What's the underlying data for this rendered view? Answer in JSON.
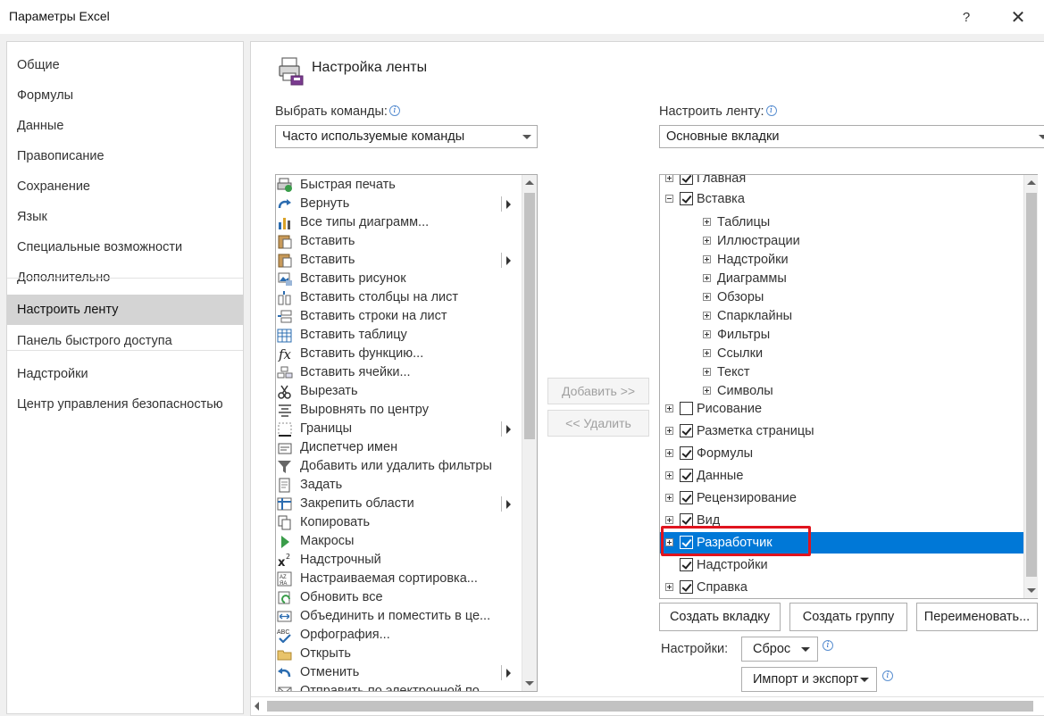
{
  "window": {
    "title": "Параметры Excel",
    "help": "?",
    "close": "✕"
  },
  "nav": {
    "items": [
      "Общие",
      "Формулы",
      "Данные",
      "Правописание",
      "Сохранение",
      "Язык",
      "Специальные возможности",
      "Дополнительно",
      "Настроить ленту",
      "Панель быстрого доступа",
      "Надстройки",
      "Центр управления безопасностью"
    ],
    "selected": "Настроить ленту"
  },
  "header": {
    "title": "Настройка ленты",
    "icon": "ribbon-customize-icon"
  },
  "commands": {
    "label": "Выбрать команды:",
    "value": "Часто используемые команды",
    "items": [
      {
        "label": "Быстрая печать",
        "icon": "quick-print-icon"
      },
      {
        "label": "Вернуть",
        "icon": "redo-icon",
        "submenu": true
      },
      {
        "label": "Все типы диаграмм...",
        "icon": "chart-types-icon"
      },
      {
        "label": "Вставить",
        "icon": "paste-icon"
      },
      {
        "label": "Вставить",
        "icon": "paste-options-icon",
        "submenu": true
      },
      {
        "label": "Вставить рисунок",
        "icon": "insert-picture-icon"
      },
      {
        "label": "Вставить столбцы на лист",
        "icon": "insert-columns-icon"
      },
      {
        "label": "Вставить строки на лист",
        "icon": "insert-rows-icon"
      },
      {
        "label": "Вставить таблицу",
        "icon": "insert-table-icon"
      },
      {
        "label": "Вставить функцию...",
        "icon": "insert-function-icon"
      },
      {
        "label": "Вставить ячейки...",
        "icon": "insert-cells-icon"
      },
      {
        "label": "Вырезать",
        "icon": "cut-icon"
      },
      {
        "label": "Выровнять по центру",
        "icon": "align-center-icon"
      },
      {
        "label": "Границы",
        "icon": "borders-icon",
        "submenu": true
      },
      {
        "label": "Диспетчер имен",
        "icon": "name-manager-icon"
      },
      {
        "label": "Добавить или удалить фильтры",
        "icon": "filter-icon"
      },
      {
        "label": "Задать",
        "icon": "set-print-area-icon"
      },
      {
        "label": "Закрепить области",
        "icon": "freeze-panes-icon",
        "submenu": true
      },
      {
        "label": "Копировать",
        "icon": "copy-icon"
      },
      {
        "label": "Макросы",
        "icon": "macros-icon"
      },
      {
        "label": "Надстрочный",
        "icon": "superscript-icon"
      },
      {
        "label": "Настраиваемая сортировка...",
        "icon": "custom-sort-icon"
      },
      {
        "label": "Обновить все",
        "icon": "refresh-all-icon"
      },
      {
        "label": "Объединить и поместить в це...",
        "icon": "merge-center-icon"
      },
      {
        "label": "Орфография...",
        "icon": "spelling-icon"
      },
      {
        "label": "Открыть",
        "icon": "open-folder-icon"
      },
      {
        "label": "Отменить",
        "icon": "undo-icon",
        "submenu": true
      },
      {
        "label": "Отправить по электронной по...",
        "icon": "email-icon"
      }
    ]
  },
  "buttons": {
    "add": "Добавить >>",
    "remove": "<< Удалить"
  },
  "ribbon": {
    "label": "Настроить ленту:",
    "value": "Основные вкладки",
    "tree": [
      {
        "label": "Главная",
        "level": 0,
        "expander": "plus",
        "checked": true
      },
      {
        "label": "Вставка",
        "level": 0,
        "expander": "minus",
        "checked": true
      },
      {
        "label": "Таблицы",
        "level": 1,
        "expander": "plus"
      },
      {
        "label": "Иллюстрации",
        "level": 1,
        "expander": "plus"
      },
      {
        "label": "Надстройки",
        "level": 1,
        "expander": "plus"
      },
      {
        "label": "Диаграммы",
        "level": 1,
        "expander": "plus"
      },
      {
        "label": "Обзоры",
        "level": 1,
        "expander": "plus"
      },
      {
        "label": "Спарклайны",
        "level": 1,
        "expander": "plus"
      },
      {
        "label": "Фильтры",
        "level": 1,
        "expander": "plus"
      },
      {
        "label": "Ссылки",
        "level": 1,
        "expander": "plus"
      },
      {
        "label": "Текст",
        "level": 1,
        "expander": "plus"
      },
      {
        "label": "Символы",
        "level": 1,
        "expander": "plus"
      },
      {
        "label": "Рисование",
        "level": 0,
        "expander": "plus",
        "checked": false
      },
      {
        "label": "Разметка страницы",
        "level": 0,
        "expander": "plus",
        "checked": true
      },
      {
        "label": "Формулы",
        "level": 0,
        "expander": "plus",
        "checked": true
      },
      {
        "label": "Данные",
        "level": 0,
        "expander": "plus",
        "checked": true
      },
      {
        "label": "Рецензирование",
        "level": 0,
        "expander": "plus",
        "checked": true
      },
      {
        "label": "Вид",
        "level": 0,
        "expander": "plus",
        "checked": true
      },
      {
        "label": "Разработчик",
        "level": 0,
        "expander": "plus",
        "checked": true,
        "selected": true
      },
      {
        "label": "Надстройки",
        "level": 0,
        "expander": "none",
        "checked": true
      },
      {
        "label": "Справка",
        "level": 0,
        "expander": "plus",
        "checked": true
      }
    ],
    "create_tab": "Создать вкладку",
    "create_group": "Создать группу",
    "rename": "Переименовать...",
    "settings_label": "Настройки:",
    "reset": "Сброс",
    "import_export": "Импорт и экспорт"
  },
  "colors": {
    "selection": "#0078d7",
    "highlight": "#e0141e",
    "nav_selected": "#d4d4d4"
  }
}
